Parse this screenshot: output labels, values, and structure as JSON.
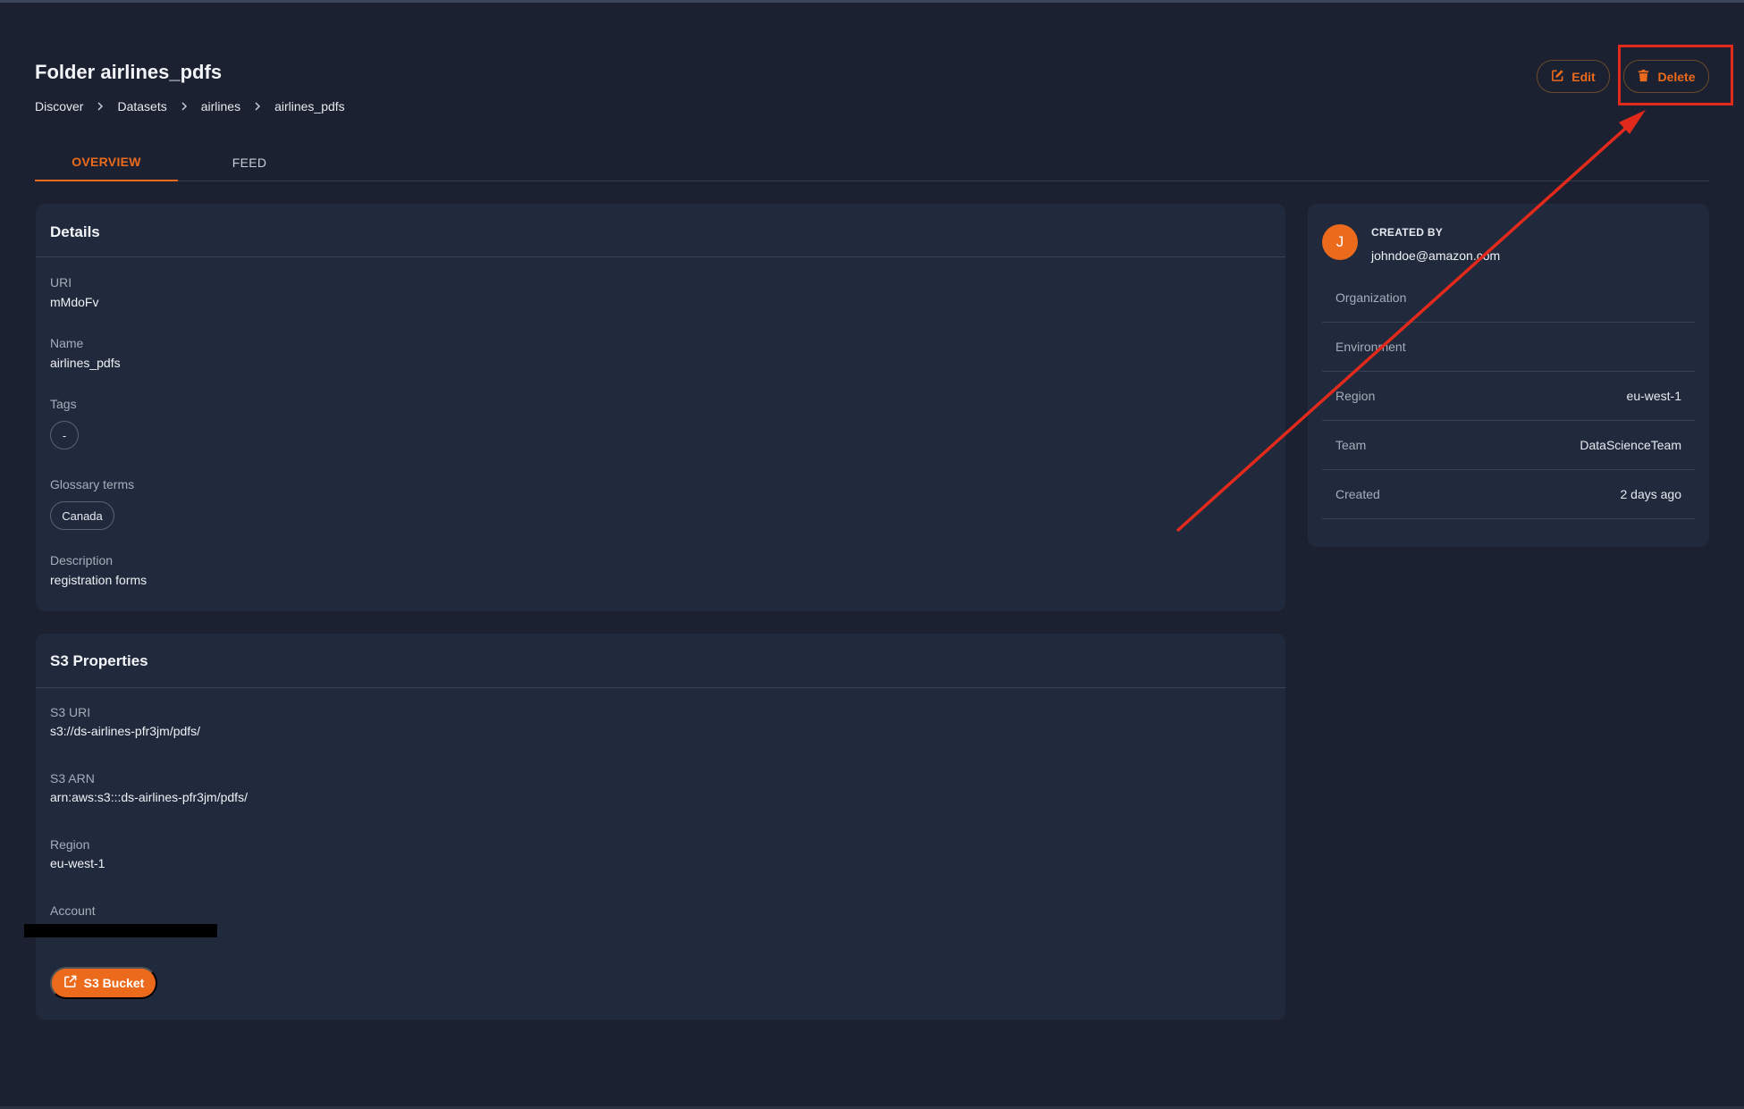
{
  "header": {
    "title": "Folder airlines_pdfs",
    "breadcrumb": [
      "Discover",
      "Datasets",
      "airlines",
      "airlines_pdfs"
    ],
    "edit_label": "Edit",
    "delete_label": "Delete"
  },
  "tabs": [
    {
      "label": "OVERVIEW",
      "active": true
    },
    {
      "label": "FEED",
      "active": false
    }
  ],
  "details": {
    "title": "Details",
    "uri_label": "URI",
    "uri_value": "mMdoFv",
    "name_label": "Name",
    "name_value": "airlines_pdfs",
    "tags_label": "Tags",
    "tags": [
      "-"
    ],
    "glossary_label": "Glossary terms",
    "glossary_terms": [
      "Canada"
    ],
    "description_label": "Description",
    "description_value": "registration forms"
  },
  "s3": {
    "title": "S3 Properties",
    "uri_label": "S3 URI",
    "uri_value": "s3://ds-airlines-pfr3jm/pdfs/",
    "arn_label": "S3 ARN",
    "arn_value": "arn:aws:s3:::ds-airlines-pfr3jm/pdfs/",
    "region_label": "Region",
    "region_value": "eu-west-1",
    "account_label": "Account",
    "bucket_button": "S3 Bucket"
  },
  "sidebar": {
    "avatar_initial": "J",
    "created_by_label": "CREATED BY",
    "created_by_value": "johndoe@amazon.com",
    "rows": [
      {
        "key": "Organization",
        "value": ""
      },
      {
        "key": "Environment",
        "value": ""
      },
      {
        "key": "Region",
        "value": "eu-west-1"
      },
      {
        "key": "Team",
        "value": "DataScienceTeam"
      },
      {
        "key": "Created",
        "value": "2 days ago"
      }
    ]
  },
  "colors": {
    "accent": "#ec6a1c",
    "annotation": "#e12a1c",
    "background": "#1b2130",
    "card": "#212a3c"
  },
  "icons": [
    "chevron-right-icon",
    "edit-icon",
    "trash-icon",
    "external-link-icon"
  ]
}
